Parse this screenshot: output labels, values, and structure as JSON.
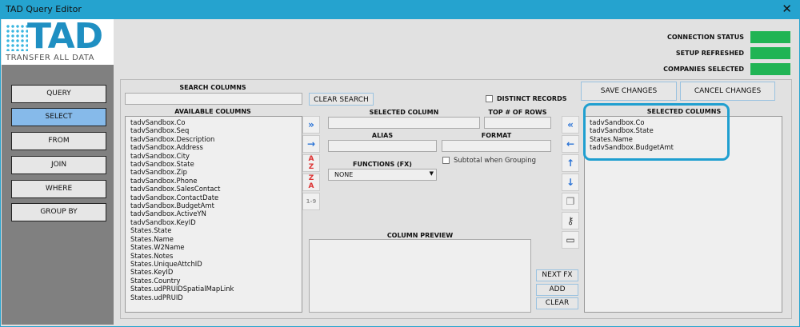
{
  "window": {
    "title": "TAD Query Editor",
    "close": "✕"
  },
  "logo": {
    "title": "TAD",
    "subtitle": "TRANSFER ALL DATA"
  },
  "nav": [
    "QUERY",
    "SELECT",
    "FROM",
    "JOIN",
    "WHERE",
    "GROUP BY"
  ],
  "nav_active": "SELECT",
  "status": [
    {
      "label": "CONNECTION STATUS",
      "color": "#20b454"
    },
    {
      "label": "SETUP REFRESHED",
      "color": "#20b454"
    },
    {
      "label": "COMPANIES SELECTED",
      "color": "#20b454"
    }
  ],
  "search": {
    "label": "SEARCH COLUMNS",
    "value": "",
    "clear": "CLEAR SEARCH"
  },
  "available": {
    "label": "AVAILABLE COLUMNS",
    "items": [
      "tadvSandbox.Co",
      "tadvSandbox.Seq",
      "tadvSandbox.Description",
      "tadvSandbox.Address",
      "tadvSandbox.City",
      "tadvSandbox.State",
      "tadvSandbox.Zip",
      "tadvSandbox.Phone",
      "tadvSandbox.SalesContact",
      "tadvSandbox.ContactDate",
      "tadvSandbox.BudgetAmt",
      "tadvSandbox.ActiveYN",
      "tadvSandbox.KeyID",
      "States.State",
      "States.Name",
      "States.W2Name",
      "States.Notes",
      "States.UniqueAttchID",
      "States.KeyID",
      "States.Country",
      "States.udPRUIDSpatialMapLink",
      "States.udPRUID"
    ]
  },
  "form": {
    "distinct": "DISTINCT RECORDS",
    "selected_column": "SELECTED COLUMN",
    "top_rows": "TOP # OF ROWS",
    "alias": "ALIAS",
    "format": "FORMAT",
    "functions": "FUNCTIONS (FX)",
    "function_value": "NONE",
    "subtotal": "Subtotal when Grouping",
    "preview": "COLUMN PREVIEW"
  },
  "buttons": {
    "save": "SAVE CHANGES",
    "cancel": "CANCEL CHANGES",
    "next_fx": "NEXT FX",
    "add": "ADD",
    "clear": "CLEAR"
  },
  "selected": {
    "label": "SELECTED COLUMNS",
    "items": [
      "tadvSandbox.Co",
      "tadvSandbox.State",
      "States.Name",
      "tadvSandbox.BudgetAmt"
    ]
  },
  "icons": {
    "sort_num": "1-9"
  }
}
